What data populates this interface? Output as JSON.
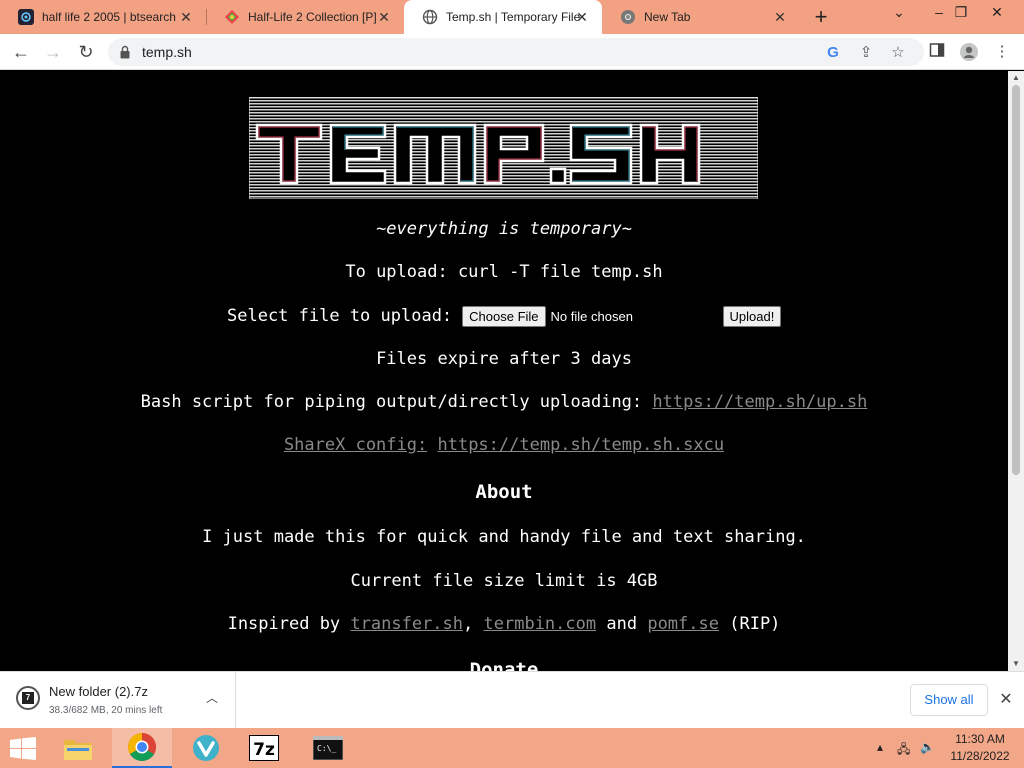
{
  "browser": {
    "tabs": [
      {
        "title": "half life 2 2005 | btsearch",
        "icon": "btsearch-favicon"
      },
      {
        "title": "Half-Life 2 Collection [P]",
        "icon": "colorful-favicon"
      },
      {
        "title": "Temp.sh | Temporary File",
        "icon": "globe-icon",
        "active": true
      },
      {
        "title": "New Tab",
        "icon": "chrome-icon"
      }
    ],
    "new_tab": "+",
    "address": "temp.sh"
  },
  "page": {
    "tagline": "~everything is temporary~",
    "upload_cmd": "To upload: curl -T file temp.sh",
    "select_label": "Select file to upload:",
    "choose_btn": "Choose File",
    "no_file": "No file chosen",
    "upload_btn": "Upload!",
    "expire": "Files expire after 3 days",
    "bash_label": "Bash script for piping output/directly uploading:",
    "bash_link": "https://temp.sh/up.sh",
    "sharex_label": "ShareX config:",
    "sharex_link": "https://temp.sh/temp.sh.sxcu",
    "about_heading": "About",
    "about_text": "I just made this for quick and handy file and text sharing.",
    "size_limit": "Current file size limit is 4GB",
    "inspired_label": "Inspired by",
    "inspired_links": [
      "transfer.sh",
      "termbin.com",
      "pomf.se"
    ],
    "comma": ",",
    "and_word": "and",
    "rip": "(RIP)",
    "donate_heading": "Donate"
  },
  "download": {
    "file": "New folder (2).7z",
    "status": "38.3/682 MB, 20 mins left",
    "show_all": "Show all"
  },
  "taskbar": {
    "apps": [
      "file-explorer-icon",
      "chrome-icon",
      "vivaldi-icon",
      "7zip-icon",
      "cmd-icon"
    ],
    "time": "11:30 AM",
    "date": "11/28/2022"
  },
  "colors": {
    "tab_strip": "#f3a183",
    "taskbar": "#f2a788",
    "link": "#8a8a8a"
  }
}
